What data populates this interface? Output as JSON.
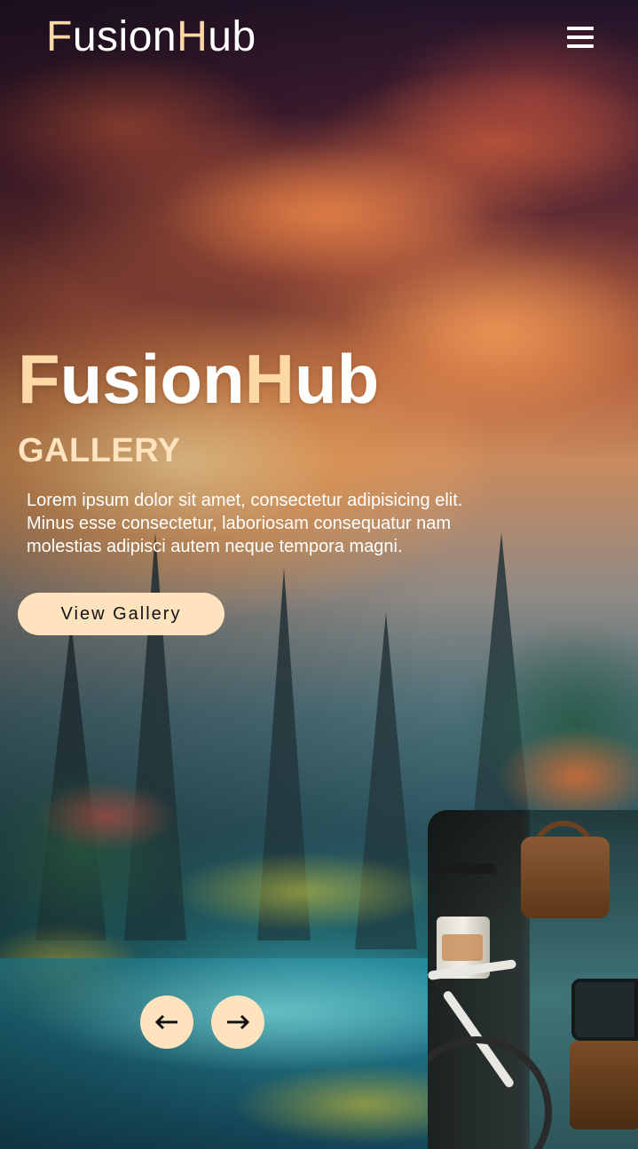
{
  "header": {
    "logo_initial_1": "F",
    "logo_part_1": "usion",
    "logo_initial_2": "H",
    "logo_part_2": "ub",
    "menu_icon": "hamburger-menu-icon"
  },
  "hero": {
    "title_initial_1": "F",
    "title_part_1": "usion",
    "title_initial_2": "H",
    "title_part_2": "ub",
    "subtitle": "GALLERY",
    "description": "Lorem ipsum dolor sit amet, consectetur adipisicing elit. Minus esse consectetur, laboriosam consequatur nam molestias adipisci autem neque tempora magni.",
    "cta_label": "View Gallery"
  },
  "carousel": {
    "prev_icon": "arrow-left-icon",
    "next_icon": "arrow-right-icon"
  },
  "colors": {
    "accent": "#ffe3bf",
    "text": "#ffffff",
    "button_text": "#111111"
  }
}
